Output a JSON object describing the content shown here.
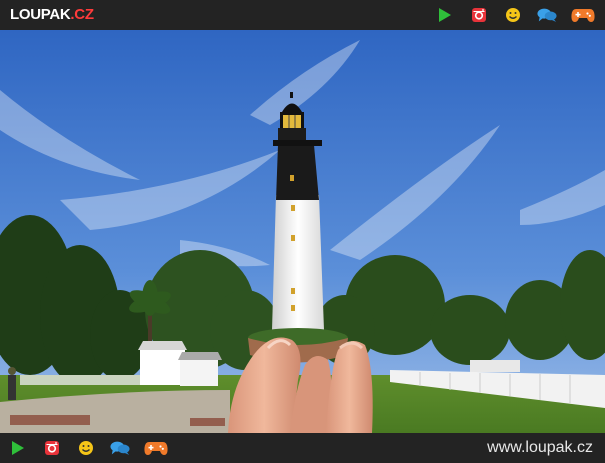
{
  "header": {
    "logo_main": "LOUPAK",
    "logo_tld": ".CZ",
    "icons": [
      "play-icon",
      "instagram-icon",
      "smiley-icon",
      "chat-icon",
      "gamepad-icon"
    ]
  },
  "footer": {
    "url": "www.loupak.cz",
    "icons": [
      "play-icon",
      "instagram-icon",
      "smiley-icon",
      "chat-icon",
      "gamepad-icon"
    ]
  },
  "colors": {
    "bar": "#232323",
    "play": "#2fbf3a",
    "instagram": "#e8333a",
    "smiley": "#f5c518",
    "chat": "#3aa0e8",
    "gamepad": "#f07a2a",
    "logo_accent": "#ff3b3b"
  },
  "photo": {
    "subject": "miniature lighthouse held between fingers in forced perspective"
  }
}
